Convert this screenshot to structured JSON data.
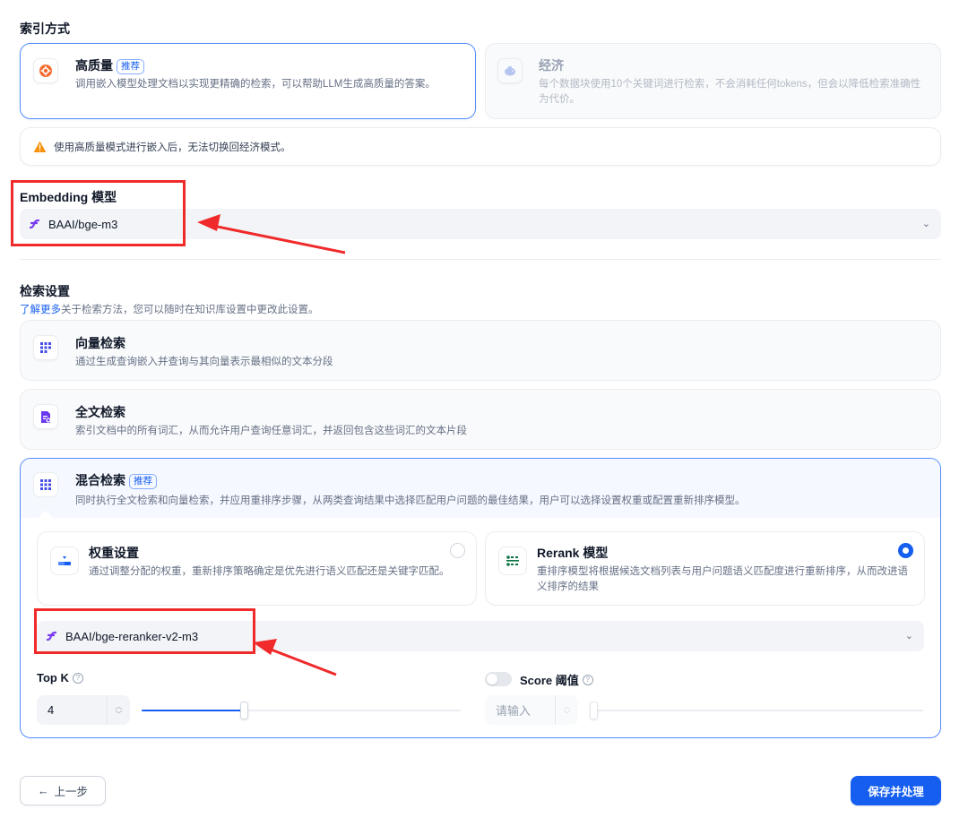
{
  "index_mode": {
    "title": "索引方式",
    "high_quality": {
      "title": "高质量",
      "badge": "推荐",
      "desc": "调用嵌入模型处理文档以实现更精确的检索，可以帮助LLM生成高质量的答案。"
    },
    "economy": {
      "title": "经济",
      "desc": "每个数据块使用10个关键词进行检索，不会消耗任何tokens，但会以降低检索准确性为代价。"
    },
    "warning": "使用高质量模式进行嵌入后，无法切换回经济模式。"
  },
  "embedding": {
    "label": "Embedding 模型",
    "model": "BAAI/bge-m3"
  },
  "retrieval": {
    "title": "检索设置",
    "learn_more": "了解更多",
    "learn_suffix": "关于检索方法，您可以随时在知识库设置中更改此设置。",
    "vector": {
      "title": "向量检索",
      "desc": "通过生成查询嵌入并查询与其向量表示最相似的文本分段"
    },
    "fulltext": {
      "title": "全文检索",
      "desc": "索引文档中的所有词汇，从而允许用户查询任意词汇，并返回包含这些词汇的文本片段"
    },
    "hybrid": {
      "title": "混合检索",
      "badge": "推荐",
      "desc": "同时执行全文检索和向量检索，并应用重排序步骤，从两类查询结果中选择匹配用户问题的最佳结果，用户可以选择设置权重或配置重新排序模型。",
      "weight": {
        "title": "权重设置",
        "desc": "通过调整分配的权重，重新排序策略确定是优先进行语义匹配还是关键字匹配。",
        "selected": false
      },
      "rerank": {
        "title": "Rerank 模型",
        "desc": "重排序模型将根据候选文档列表与用户问题语义匹配度进行重新排序，从而改进语义排序的结果",
        "selected": true
      },
      "rerank_model": "BAAI/bge-reranker-v2-m3",
      "top_k": {
        "label": "Top K",
        "value": "4",
        "slider_fraction": 0.32
      },
      "score": {
        "label": "Score 阈值",
        "placeholder": "请输入",
        "enabled": false
      }
    }
  },
  "buttons": {
    "back": "上一步",
    "save": "保存并处理"
  },
  "colors": {
    "primary": "#155eef",
    "annotation": "#f02a2a",
    "warning": "#f79009"
  }
}
